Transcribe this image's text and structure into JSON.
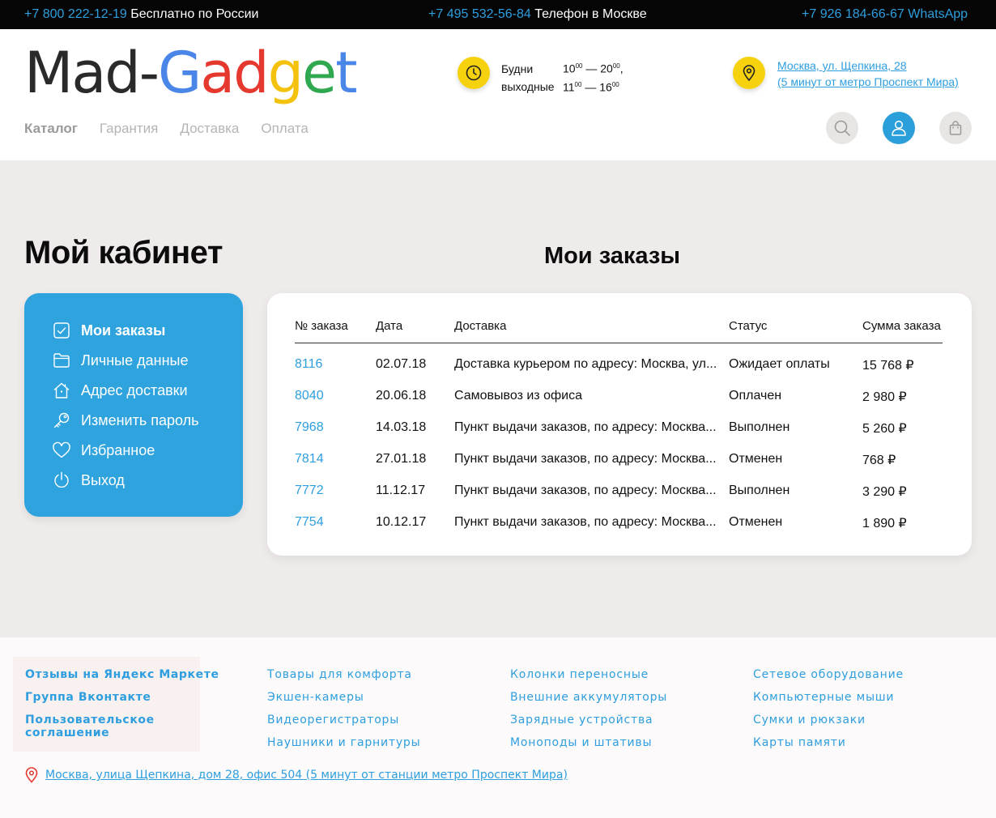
{
  "topbar": {
    "phone1": "+7 800 222-12-19",
    "label1": "Бесплатно по России",
    "phone2": "+7 495 532-56-84",
    "label2": "Телефон в Москве",
    "phone3": "+7 926 184-66-67",
    "label3": "WhatsApp"
  },
  "header": {
    "logo": {
      "part1": "Mad-",
      "G": "G",
      "a": "a",
      "d": "d",
      "g": "g",
      "e": "e",
      "t": "t"
    },
    "hours": {
      "weekdays_label": "Будни",
      "weekdays_from": "10",
      "weekdays_to": "20",
      "weekend_label": "выходные",
      "weekend_from": "11",
      "weekend_to": "16",
      "minutes": "00",
      "dash": " — ",
      "comma": ","
    },
    "address": {
      "line1": "Москва, ул. Щепкина, 28",
      "line2": "(5 минут от метро Проспект Мира)"
    },
    "nav": [
      "Каталог",
      "Гарантия",
      "Доставка",
      "Оплата"
    ],
    "icons": {
      "search": "search-icon",
      "user": "user-icon",
      "cart": "bag-icon"
    }
  },
  "colors": {
    "accent": "#2ea3de",
    "yellow": "#f5d20d",
    "logo_blue": "#4a86e8",
    "logo_red": "#e5392f",
    "logo_yellow": "#f4c20d",
    "logo_green": "#2fa84f"
  },
  "main": {
    "page_title": "Мой кабинет",
    "section_title": "Мои заказы",
    "sidebar": [
      {
        "label": "Мои заказы",
        "icon": "checkbox-icon"
      },
      {
        "label": "Личные данные",
        "icon": "folder-icon"
      },
      {
        "label": "Адрес доставки",
        "icon": "home-icon"
      },
      {
        "label": "Изменить пароль",
        "icon": "key-icon"
      },
      {
        "label": "Избранное",
        "icon": "heart-icon"
      },
      {
        "label": "Выход",
        "icon": "power-icon"
      }
    ],
    "orders": {
      "columns": [
        "№ заказа",
        "Дата",
        "Доставка",
        "Статус",
        "Сумма заказа"
      ],
      "rows": [
        [
          "8116",
          "02.07.18",
          "Доставка курьером по адресу: Москва, ул...",
          "Ожидает оплаты",
          "15 768 ₽"
        ],
        [
          "8040",
          "20.06.18",
          "Самовывоз из офиса",
          "Оплачен",
          "2 980 ₽"
        ],
        [
          "7968",
          "14.03.18",
          "Пункт выдачи заказов, по адресу: Москва...",
          "Выполнен",
          "5 260 ₽"
        ],
        [
          "7814",
          "27.01.18",
          "Пункт выдачи заказов, по адресу: Москва...",
          "Отменен",
          "768 ₽"
        ],
        [
          "7772",
          "11.12.17",
          "Пункт выдачи заказов, по адресу: Москва...",
          "Выполнен",
          "3 290 ₽"
        ],
        [
          "7754",
          "10.12.17",
          "Пункт выдачи заказов, по адресу: Москва...",
          "Отменен",
          "1 890 ₽"
        ]
      ]
    }
  },
  "footer": {
    "col1": [
      "Отзывы на Яндекс Маркете",
      "Группа Вконтакте",
      "Пользовательское",
      "соглашение"
    ],
    "col2": [
      "Товары для комфорта",
      "Экшен-камеры",
      "Видеорегистраторы",
      "Наушники и гарнитуры"
    ],
    "col3": [
      "Колонки переносные",
      "Внешние аккумуляторы",
      "Зарядные устройства",
      "Моноподы и штативы"
    ],
    "col4": [
      "Сетевое оборудование",
      "Компьютерные мыши",
      "Сумки и рюкзаки",
      "Карты памяти"
    ],
    "address": "Москва, улица Щепкина, дом 28, офис 504 (5 минут от станции метро Проспект Мира)"
  }
}
